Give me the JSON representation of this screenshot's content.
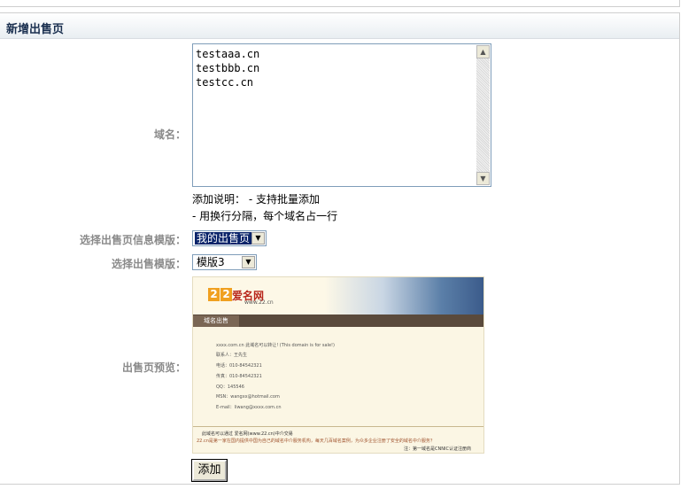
{
  "panel": {
    "title": "新增出售页"
  },
  "form": {
    "domain": {
      "label": "域名：",
      "lines": [
        "testaaa.cn",
        "testbbb.cn",
        "testcc.cn"
      ]
    },
    "help": {
      "line1": "添加说明： - 支持批量添加",
      "line2": "- 用换行分隔，每个域名占一行"
    },
    "info_template": {
      "label": "选择出售页信息模版：",
      "value": "我的出售页"
    },
    "template": {
      "label": "选择出售模版：",
      "value": "模版3"
    },
    "preview": {
      "label": "出售页预览："
    },
    "submit_label": "添加"
  },
  "preview_image": {
    "logo_digits": [
      "2",
      "2"
    ],
    "logo_text": "爱名网",
    "logo_url": "www.22.cn",
    "tab_label": "域名出售",
    "lines": [
      "xxxx.com.cn  此域名可以转让! (This domain is for sale!)",
      "联系人：王先生",
      "电话：010-84542321",
      "传真：010-84542321",
      "QQ：145546",
      "MSN：wangxx@hotmail.com",
      "E-mail：liwang@xxxx.com.cn"
    ],
    "footer_line1": "此域名可以通过 爱名网(www.22.cn)中介交易",
    "footer_line2": "22.cn是第一家在国内提供中国为自己的域名中介服务机构，每天几百域名案例，为众多企业注册了安全的域名中介服务？",
    "footer_line3": "注：第一域名是CNNIC认证注册商",
    "colors": {
      "logo_orange": "#f0a020",
      "logo_red": "#b8261b"
    }
  }
}
